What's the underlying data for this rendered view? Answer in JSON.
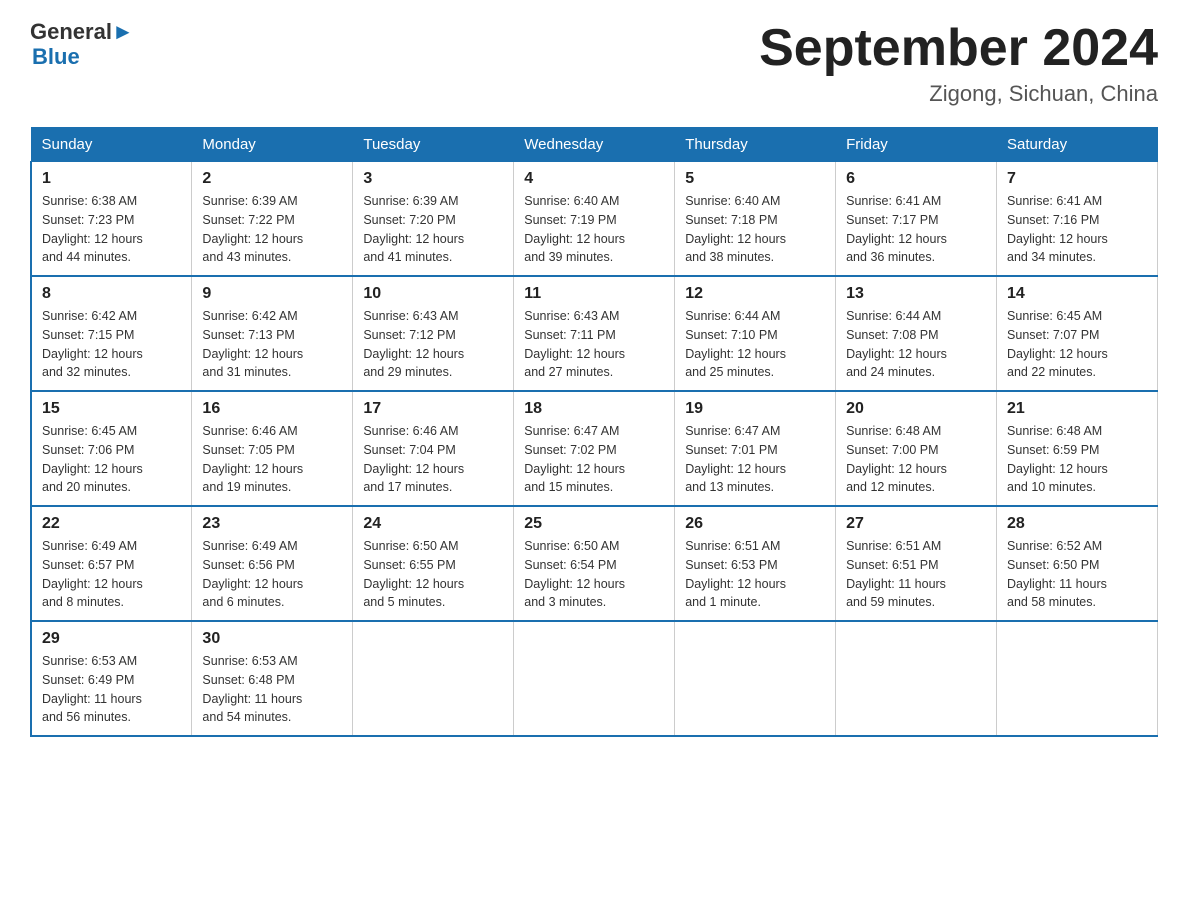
{
  "header": {
    "logo_text_general": "General",
    "logo_text_blue": "Blue",
    "month_title": "September 2024",
    "location": "Zigong, Sichuan, China"
  },
  "days_of_week": [
    "Sunday",
    "Monday",
    "Tuesday",
    "Wednesday",
    "Thursday",
    "Friday",
    "Saturday"
  ],
  "weeks": [
    [
      {
        "day": "1",
        "sunrise": "6:38 AM",
        "sunset": "7:23 PM",
        "daylight": "12 hours and 44 minutes."
      },
      {
        "day": "2",
        "sunrise": "6:39 AM",
        "sunset": "7:22 PM",
        "daylight": "12 hours and 43 minutes."
      },
      {
        "day": "3",
        "sunrise": "6:39 AM",
        "sunset": "7:20 PM",
        "daylight": "12 hours and 41 minutes."
      },
      {
        "day": "4",
        "sunrise": "6:40 AM",
        "sunset": "7:19 PM",
        "daylight": "12 hours and 39 minutes."
      },
      {
        "day": "5",
        "sunrise": "6:40 AM",
        "sunset": "7:18 PM",
        "daylight": "12 hours and 38 minutes."
      },
      {
        "day": "6",
        "sunrise": "6:41 AM",
        "sunset": "7:17 PM",
        "daylight": "12 hours and 36 minutes."
      },
      {
        "day": "7",
        "sunrise": "6:41 AM",
        "sunset": "7:16 PM",
        "daylight": "12 hours and 34 minutes."
      }
    ],
    [
      {
        "day": "8",
        "sunrise": "6:42 AM",
        "sunset": "7:15 PM",
        "daylight": "12 hours and 32 minutes."
      },
      {
        "day": "9",
        "sunrise": "6:42 AM",
        "sunset": "7:13 PM",
        "daylight": "12 hours and 31 minutes."
      },
      {
        "day": "10",
        "sunrise": "6:43 AM",
        "sunset": "7:12 PM",
        "daylight": "12 hours and 29 minutes."
      },
      {
        "day": "11",
        "sunrise": "6:43 AM",
        "sunset": "7:11 PM",
        "daylight": "12 hours and 27 minutes."
      },
      {
        "day": "12",
        "sunrise": "6:44 AM",
        "sunset": "7:10 PM",
        "daylight": "12 hours and 25 minutes."
      },
      {
        "day": "13",
        "sunrise": "6:44 AM",
        "sunset": "7:08 PM",
        "daylight": "12 hours and 24 minutes."
      },
      {
        "day": "14",
        "sunrise": "6:45 AM",
        "sunset": "7:07 PM",
        "daylight": "12 hours and 22 minutes."
      }
    ],
    [
      {
        "day": "15",
        "sunrise": "6:45 AM",
        "sunset": "7:06 PM",
        "daylight": "12 hours and 20 minutes."
      },
      {
        "day": "16",
        "sunrise": "6:46 AM",
        "sunset": "7:05 PM",
        "daylight": "12 hours and 19 minutes."
      },
      {
        "day": "17",
        "sunrise": "6:46 AM",
        "sunset": "7:04 PM",
        "daylight": "12 hours and 17 minutes."
      },
      {
        "day": "18",
        "sunrise": "6:47 AM",
        "sunset": "7:02 PM",
        "daylight": "12 hours and 15 minutes."
      },
      {
        "day": "19",
        "sunrise": "6:47 AM",
        "sunset": "7:01 PM",
        "daylight": "12 hours and 13 minutes."
      },
      {
        "day": "20",
        "sunrise": "6:48 AM",
        "sunset": "7:00 PM",
        "daylight": "12 hours and 12 minutes."
      },
      {
        "day": "21",
        "sunrise": "6:48 AM",
        "sunset": "6:59 PM",
        "daylight": "12 hours and 10 minutes."
      }
    ],
    [
      {
        "day": "22",
        "sunrise": "6:49 AM",
        "sunset": "6:57 PM",
        "daylight": "12 hours and 8 minutes."
      },
      {
        "day": "23",
        "sunrise": "6:49 AM",
        "sunset": "6:56 PM",
        "daylight": "12 hours and 6 minutes."
      },
      {
        "day": "24",
        "sunrise": "6:50 AM",
        "sunset": "6:55 PM",
        "daylight": "12 hours and 5 minutes."
      },
      {
        "day": "25",
        "sunrise": "6:50 AM",
        "sunset": "6:54 PM",
        "daylight": "12 hours and 3 minutes."
      },
      {
        "day": "26",
        "sunrise": "6:51 AM",
        "sunset": "6:53 PM",
        "daylight": "12 hours and 1 minute."
      },
      {
        "day": "27",
        "sunrise": "6:51 AM",
        "sunset": "6:51 PM",
        "daylight": "11 hours and 59 minutes."
      },
      {
        "day": "28",
        "sunrise": "6:52 AM",
        "sunset": "6:50 PM",
        "daylight": "11 hours and 58 minutes."
      }
    ],
    [
      {
        "day": "29",
        "sunrise": "6:53 AM",
        "sunset": "6:49 PM",
        "daylight": "11 hours and 56 minutes."
      },
      {
        "day": "30",
        "sunrise": "6:53 AM",
        "sunset": "6:48 PM",
        "daylight": "11 hours and 54 minutes."
      },
      null,
      null,
      null,
      null,
      null
    ]
  ],
  "labels": {
    "sunrise": "Sunrise:",
    "sunset": "Sunset:",
    "daylight": "Daylight:"
  }
}
